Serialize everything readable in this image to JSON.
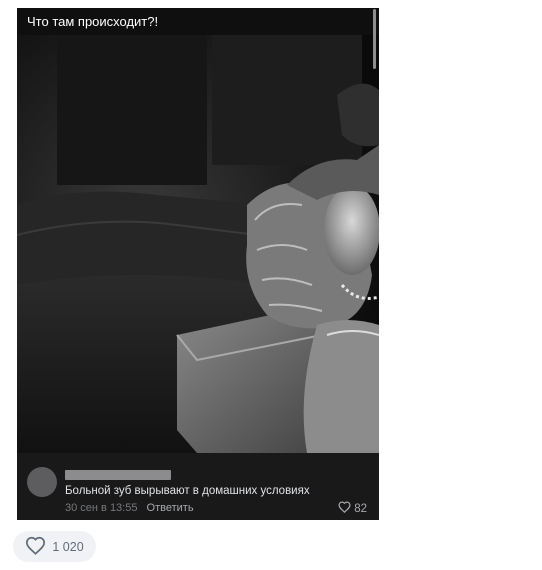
{
  "post": {
    "caption": "Что там происходит?!",
    "image_alt": "black-and-white photo"
  },
  "comment": {
    "text": "Больной зуб вырывают в домашних условиях",
    "time": "30 сен в 13:55",
    "reply_label": "Ответить",
    "likes": "82"
  },
  "reactions": {
    "likes": "1 020"
  },
  "icons": {
    "comment_like": "heart-icon",
    "post_like": "heart-icon"
  },
  "colors": {
    "card_background": "#19191a",
    "comment_text": "#e1e3e6",
    "muted_text": "#76787a",
    "like_pill_background": "#f0f2f5"
  }
}
